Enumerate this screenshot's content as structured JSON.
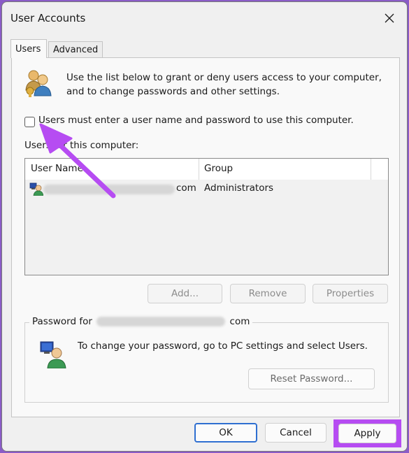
{
  "window": {
    "title": "User Accounts"
  },
  "tabs": [
    {
      "label": "Users",
      "active": true
    },
    {
      "label": "Advanced",
      "active": false
    }
  ],
  "intro_text": "Use the list below to grant or deny users access to your computer, and to change passwords and other settings.",
  "require_password": {
    "label": "Users must enter a user name and password to use this computer.",
    "checked": false
  },
  "users_list": {
    "label": "Users for this computer:",
    "columns": [
      "User Name",
      "Group"
    ],
    "rows": [
      {
        "user_name_suffix": "com",
        "group": "Administrators"
      }
    ]
  },
  "list_buttons": {
    "add": "Add...",
    "remove": "Remove",
    "properties": "Properties"
  },
  "password_group": {
    "legend_prefix": "Password for",
    "legend_suffix": "com",
    "text": "To change your password, go to PC settings and select Users.",
    "reset_button": "Reset Password..."
  },
  "footer": {
    "ok": "OK",
    "cancel": "Cancel",
    "apply": "Apply"
  },
  "colors": {
    "highlight": "#b64cf2",
    "focus": "#2f6fd1"
  }
}
